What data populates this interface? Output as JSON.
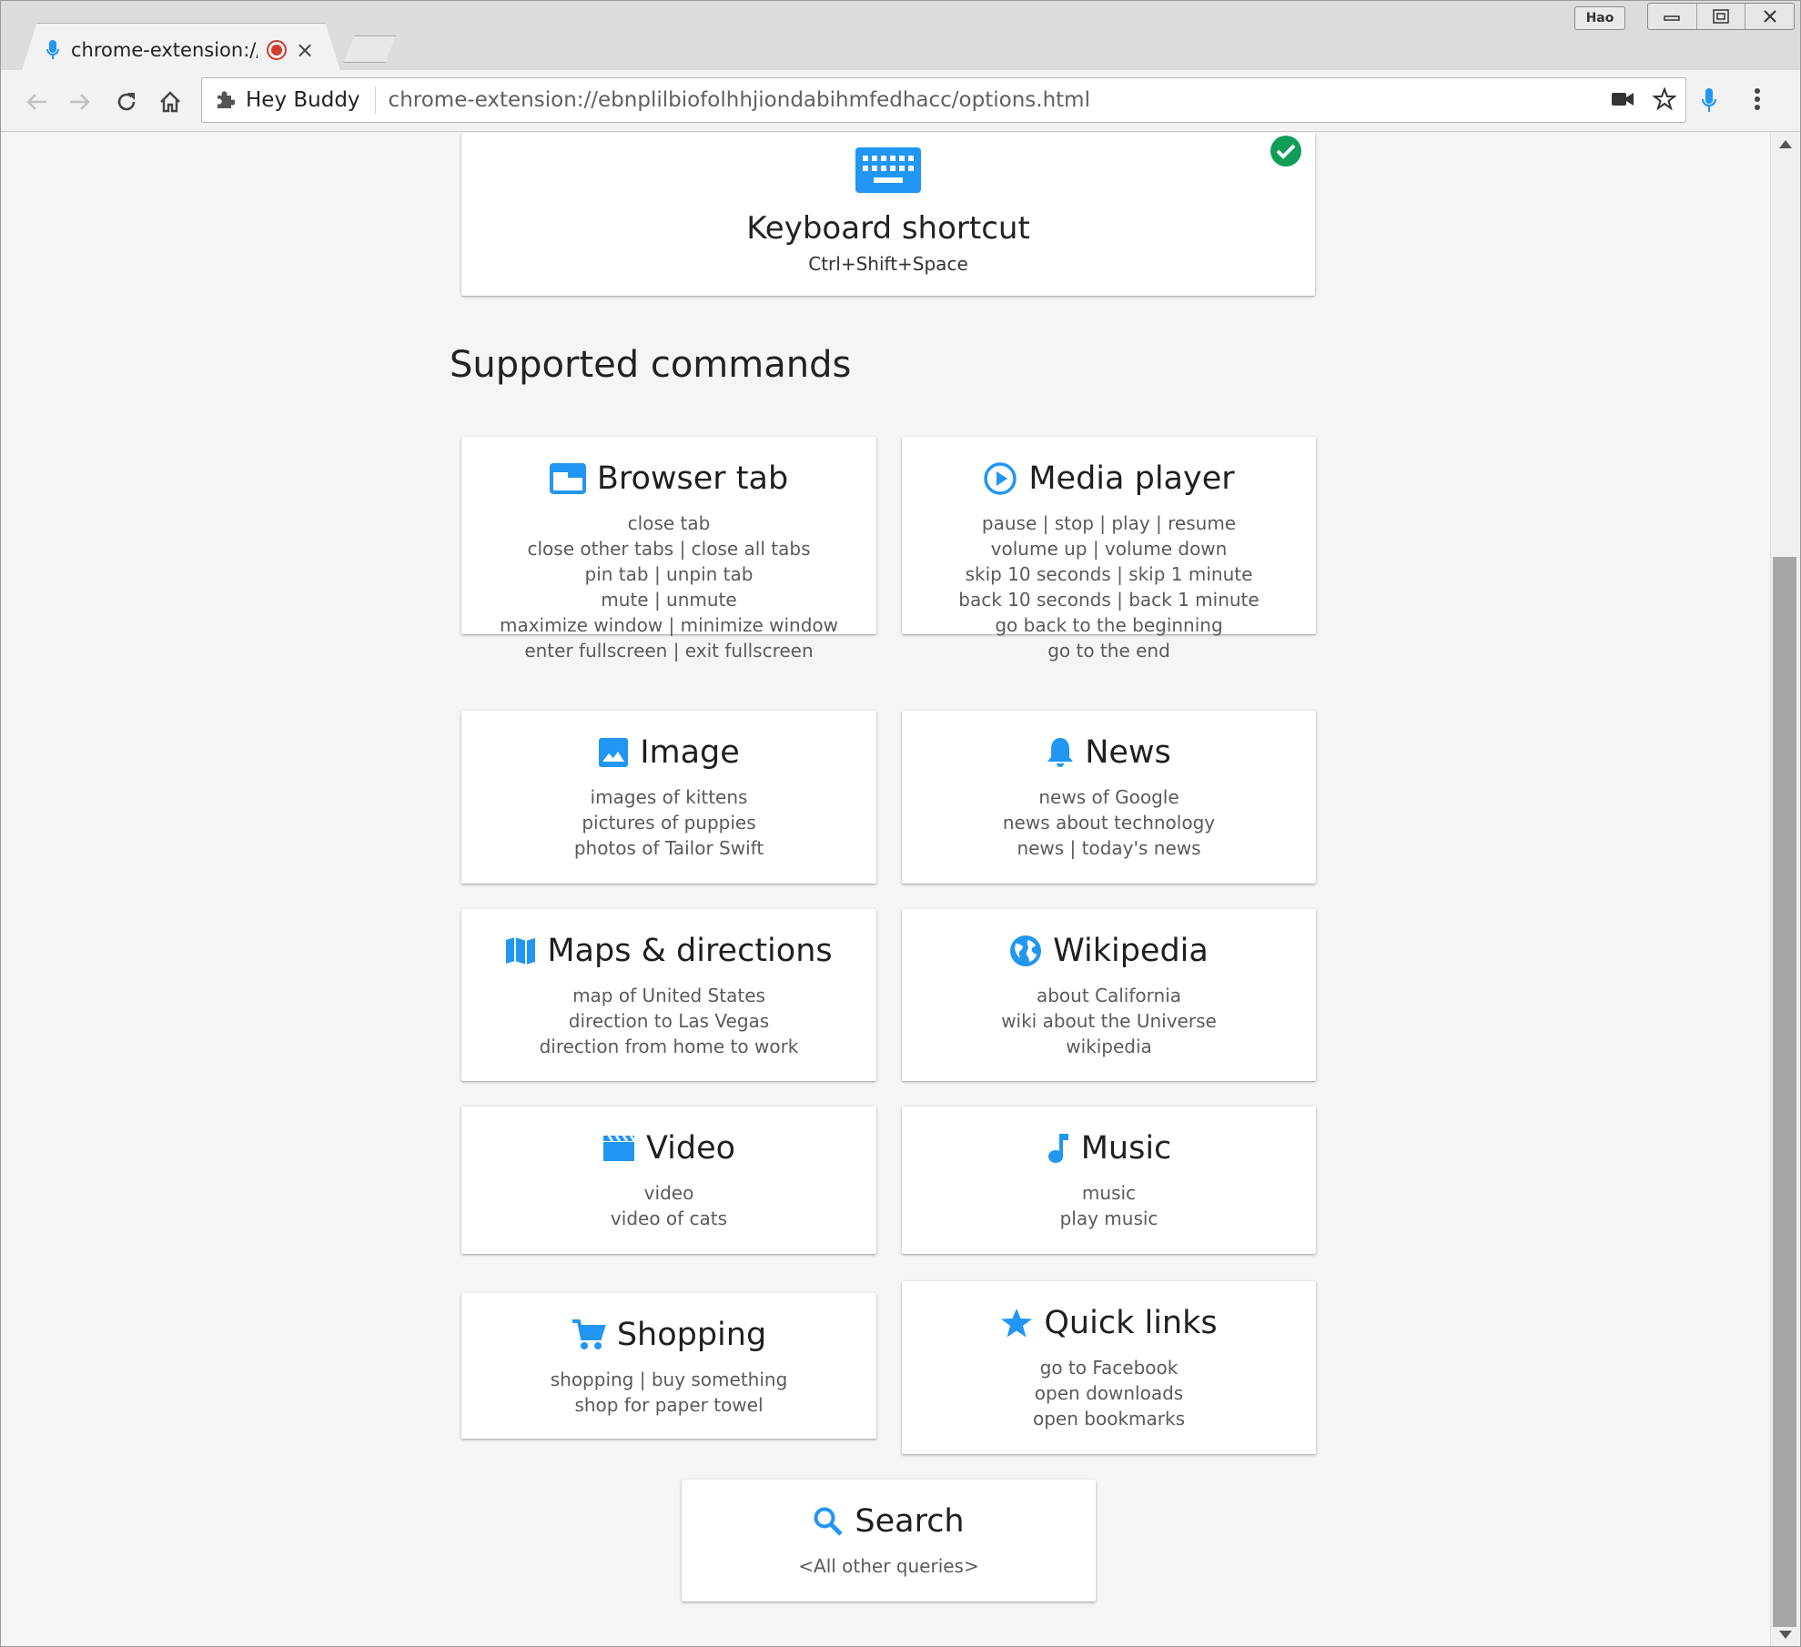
{
  "browser": {
    "tab_title": "chrome-extension://e",
    "tab_close": "×",
    "window_user": "Hao",
    "window_buttons": {
      "minimize": "▭",
      "restore": "⧉",
      "close": "✕"
    },
    "omnibox": {
      "extension_name": "Hey Buddy",
      "url": "chrome-extension://ebnplilbiofolhhjiondabihmfedhacc/options.html"
    }
  },
  "colors": {
    "accent": "#2196f3",
    "success": "#0f9d58",
    "recording": "#d23c2e"
  },
  "keyboard_card": {
    "icon": "keyboard-icon",
    "title": "Keyboard shortcut",
    "shortcut": "Ctrl+Shift+Space",
    "status_icon": "check-circle-icon"
  },
  "section_title": "Supported commands",
  "commands": [
    {
      "icon": "browser-tab-icon",
      "title": "Browser tab",
      "examples": [
        "close tab",
        "close other tabs | close all tabs",
        "pin tab | unpin tab",
        "mute | unmute",
        "maximize window | minimize window",
        "enter fullscreen | exit fullscreen"
      ]
    },
    {
      "icon": "play-circle-icon",
      "title": "Media player",
      "examples": [
        "pause | stop | play | resume",
        "volume up | volume down",
        "skip 10 seconds | skip 1 minute",
        "back 10 seconds | back 1 minute",
        "go back to the beginning",
        "go to the end"
      ]
    },
    {
      "icon": "image-icon",
      "title": "Image",
      "examples": [
        "images of kittens",
        "pictures of puppies",
        "photos of Tailor Swift"
      ]
    },
    {
      "icon": "bell-icon",
      "title": "News",
      "examples": [
        "news of Google",
        "news about technology",
        "news | today's news"
      ]
    },
    {
      "icon": "map-icon",
      "title": "Maps & directions",
      "examples": [
        "map of United States",
        "direction to Las Vegas",
        "direction from home to work"
      ]
    },
    {
      "icon": "globe-icon",
      "title": "Wikipedia",
      "examples": [
        "about California",
        "wiki about the Universe",
        "wikipedia"
      ]
    },
    {
      "icon": "movie-icon",
      "title": "Video",
      "examples": [
        "video",
        "video of cats"
      ]
    },
    {
      "icon": "music-note-icon",
      "title": "Music",
      "examples": [
        "music",
        "play music"
      ]
    },
    {
      "icon": "cart-icon",
      "title": "Shopping",
      "examples": [
        "shopping | buy something",
        "shop for paper towel"
      ]
    },
    {
      "icon": "star-icon",
      "title": "Quick links",
      "examples": [
        "go to Facebook",
        "open downloads",
        "open bookmarks"
      ]
    },
    {
      "icon": "search-icon",
      "title": "Search",
      "examples": [
        "<All other queries>"
      ]
    }
  ]
}
